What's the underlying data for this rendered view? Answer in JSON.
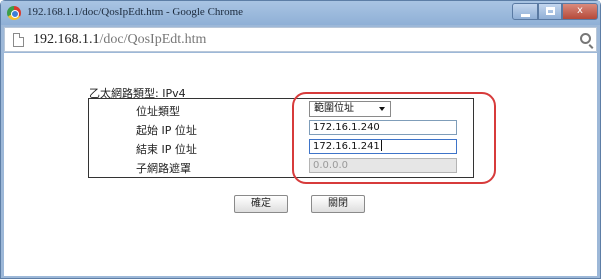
{
  "window": {
    "title": "192.168.1.1/doc/QosIpEdt.htm - Google Chrome",
    "controls": {
      "minimize": "minimize",
      "maximize": "maximize",
      "close": "x"
    }
  },
  "address": {
    "host": "192.168.1.1",
    "path": "/doc/QosIpEdt.htm"
  },
  "form": {
    "section_label": "乙太網路類型: IPv4",
    "address_type": {
      "label": "位址類型",
      "value": "範圍位址"
    },
    "start_ip": {
      "label": "起始 IP 位址",
      "value": "172.16.1.240"
    },
    "end_ip": {
      "label": "結束 IP 位址",
      "value": "172.16.1.241"
    },
    "subnet_mask": {
      "label": "子網路遮罩",
      "value": "0.0.0.0"
    }
  },
  "buttons": {
    "ok": "確定",
    "close": "關閉"
  },
  "colors": {
    "highlight": "#d73b3b",
    "titlebar": "#9db8d8"
  }
}
